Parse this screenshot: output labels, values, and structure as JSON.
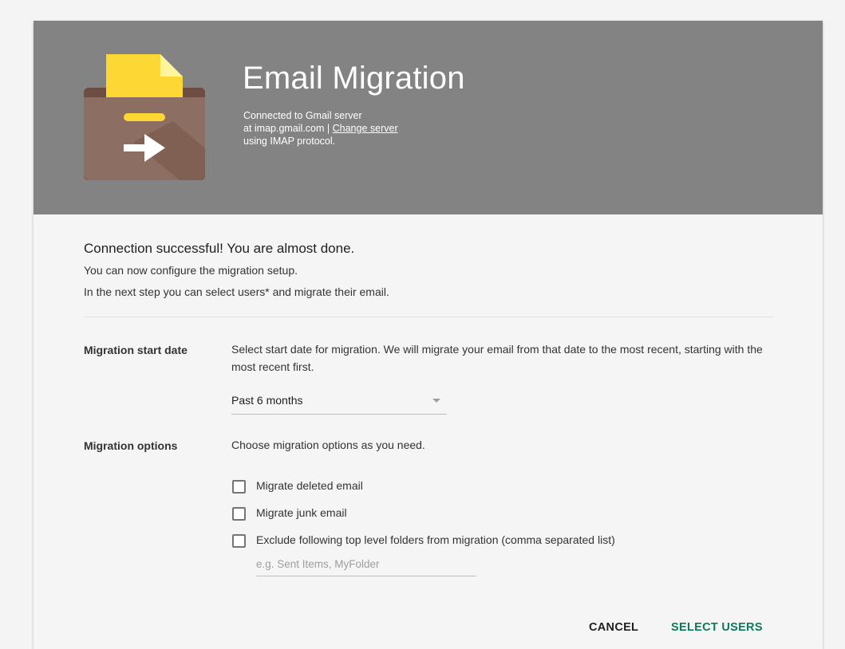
{
  "header": {
    "title": "Email Migration",
    "server_line1": "Connected to Gmail server",
    "server_line2_prefix": "at imap.gmail.com | ",
    "change_server_link": "Change server",
    "server_line3": "using IMAP protocol."
  },
  "status": {
    "headline": "Connection successful! You are almost done.",
    "line1": "You can now configure the migration setup.",
    "line2": "In the next step you can select users* and migrate their email."
  },
  "start_date": {
    "label": "Migration start date",
    "description": "Select start date for migration. We will migrate your email from that date to the most recent, starting with the most recent first.",
    "selected": "Past 6 months"
  },
  "options": {
    "label": "Migration options",
    "description": "Choose migration options as you need.",
    "items": [
      {
        "label": "Migrate deleted email",
        "checked": false
      },
      {
        "label": "Migrate junk email",
        "checked": false
      },
      {
        "label": "Exclude following top level folders from migration (comma separated list)",
        "checked": false
      }
    ],
    "folders_placeholder": "e.g. Sent Items, MyFolder"
  },
  "actions": {
    "cancel": "CANCEL",
    "select_users": "SELECT USERS"
  },
  "colors": {
    "header_bg": "#838383",
    "accent": "#0b7a5a",
    "logo_yellow": "#fdd835",
    "logo_brown": "#795548"
  },
  "icons": {
    "logo": "archive-box-with-document-and-arrow-icon",
    "dropdown": "triangle-down-icon"
  }
}
